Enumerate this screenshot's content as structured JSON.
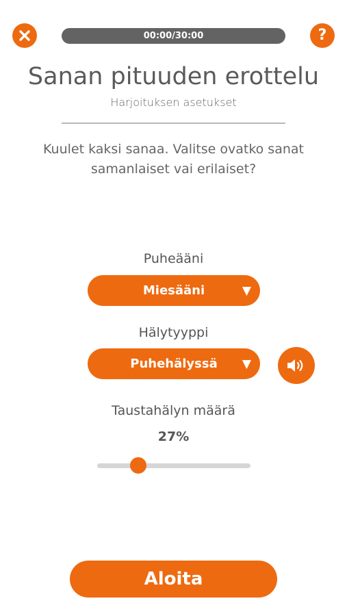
{
  "header": {
    "timer": "00:00/30:00",
    "help_symbol": "?",
    "close_icon": "close-x-icon",
    "help_icon": "question-mark-icon"
  },
  "title": "Sanan pituuden erottelu",
  "subtitle": "Harjoituksen asetukset",
  "instructions": "Kuulet kaksi sanaa. Valitse ovatko sanat samanlaiset vai erilaiset?",
  "settings": {
    "voice": {
      "label": "Puheääni",
      "selected": "Miesääni"
    },
    "noise_type": {
      "label": "Hälytyyppi",
      "selected": "Puhehälyssä",
      "preview_icon": "speaker-icon"
    },
    "noise_level": {
      "label": "Taustahälyn määrä",
      "value_text": "27%",
      "value": 0.27
    }
  },
  "start_label": "Aloita",
  "colors": {
    "accent": "#ee6a10",
    "timer_bg": "#636363",
    "track": "#d6d6d6"
  }
}
